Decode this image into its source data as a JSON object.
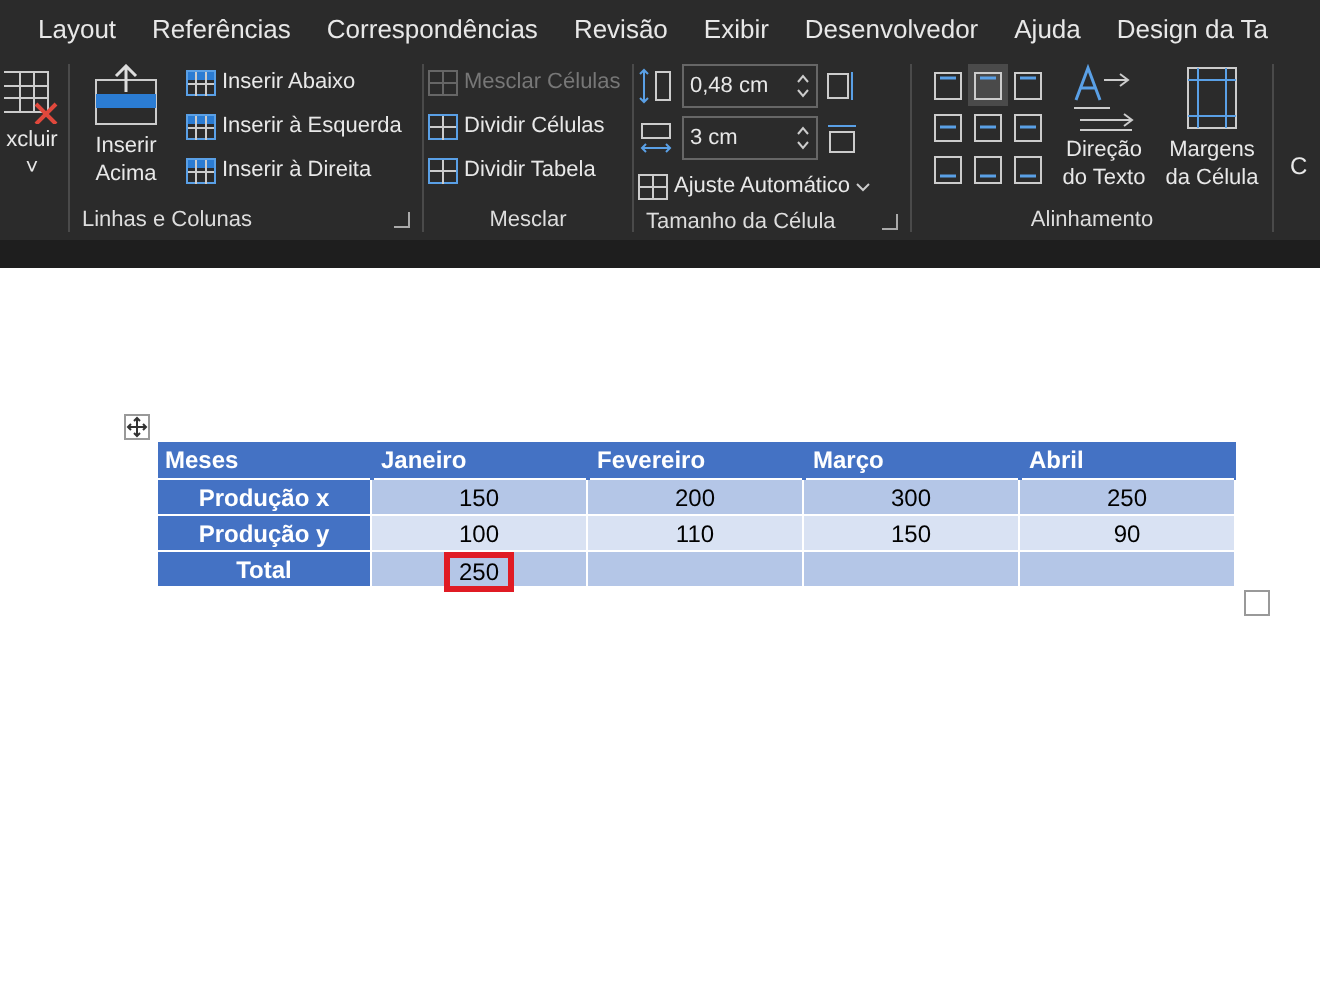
{
  "tabs": [
    "Layout",
    "Referências",
    "Correspondências",
    "Revisão",
    "Exibir",
    "Desenvolvedor",
    "Ajuda",
    "Design da Ta"
  ],
  "groups": {
    "excluir": {
      "label": "xcluir",
      "caret": "˅"
    },
    "linhas": {
      "title": "Linhas e Colunas",
      "big": "Inserir Acima",
      "items": [
        "Inserir Abaixo",
        "Inserir à Esquerda",
        "Inserir à Direita"
      ]
    },
    "mesclar": {
      "title": "Mesclar",
      "items": [
        {
          "label": "Mesclar Células",
          "disabled": true
        },
        {
          "label": "Dividir Células",
          "disabled": false
        },
        {
          "label": "Dividir Tabela",
          "disabled": false
        }
      ]
    },
    "tamanho": {
      "title": "Tamanho da Célula",
      "height": "0,48 cm",
      "width": "3 cm",
      "autofit": "Ajuste Automático"
    },
    "alinhamento": {
      "title": "Alinhamento",
      "buttons": [
        {
          "selected": false
        },
        {
          "selected": true
        },
        {
          "selected": false
        },
        {
          "selected": false
        },
        {
          "selected": false
        },
        {
          "selected": false
        },
        {
          "selected": false
        },
        {
          "selected": false
        },
        {
          "selected": false
        }
      ],
      "direction": "Direção do Texto",
      "margins": "Margens da Célula"
    },
    "partial": "C"
  },
  "table": {
    "columns": [
      "Meses",
      "Janeiro",
      "Fevereiro",
      "Março",
      "Abril"
    ],
    "rows": [
      {
        "cells": [
          {
            "kind": "header",
            "text": "Produção x"
          },
          {
            "kind": "value",
            "text": "150",
            "highlighted": false
          },
          {
            "kind": "value",
            "text": "200",
            "highlighted": false
          },
          {
            "kind": "value",
            "text": "300",
            "highlighted": false
          },
          {
            "kind": "value",
            "text": "250",
            "highlighted": false
          }
        ]
      },
      {
        "cells": [
          {
            "kind": "header",
            "text": "Produção y"
          },
          {
            "kind": "value",
            "text": "100",
            "highlighted": false
          },
          {
            "kind": "value",
            "text": "110",
            "highlighted": false
          },
          {
            "kind": "value",
            "text": "150",
            "highlighted": false
          },
          {
            "kind": "value",
            "text": "90",
            "highlighted": false
          }
        ]
      },
      {
        "cells": [
          {
            "kind": "header",
            "text": "Total"
          },
          {
            "kind": "value",
            "text": "250",
            "highlighted": true
          },
          {
            "kind": "value",
            "text": "",
            "highlighted": false
          },
          {
            "kind": "value",
            "text": "",
            "highlighted": false
          },
          {
            "kind": "value",
            "text": "",
            "highlighted": false
          }
        ]
      }
    ]
  }
}
